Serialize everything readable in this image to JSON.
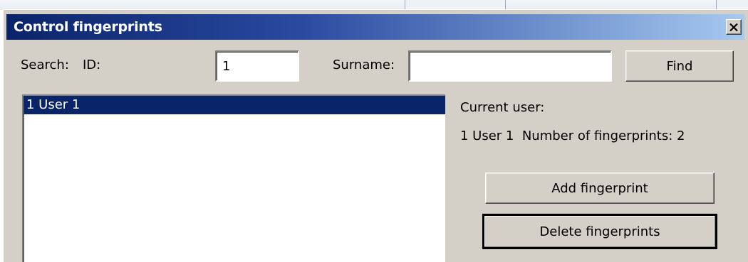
{
  "window": {
    "title": "Control fingerprints",
    "close_icon": "close-icon"
  },
  "search": {
    "search_label": "Search:",
    "id_label": "ID:",
    "id_value": "1",
    "surname_label": "Surname:",
    "surname_value": "",
    "find_label": "Find"
  },
  "user_list": {
    "items": [
      {
        "label": "1 User 1",
        "selected": true
      }
    ]
  },
  "current_user": {
    "heading": "Current user:",
    "info": "1 User 1  Number of fingerprints: 2"
  },
  "actions": {
    "add_label": "Add fingerprint",
    "delete_label": "Delete fingerprints"
  },
  "colors": {
    "title_start": "#0a246a",
    "title_end": "#a6caf0",
    "dialog_bg": "#d4d0c8",
    "selection_bg": "#0a246a"
  }
}
